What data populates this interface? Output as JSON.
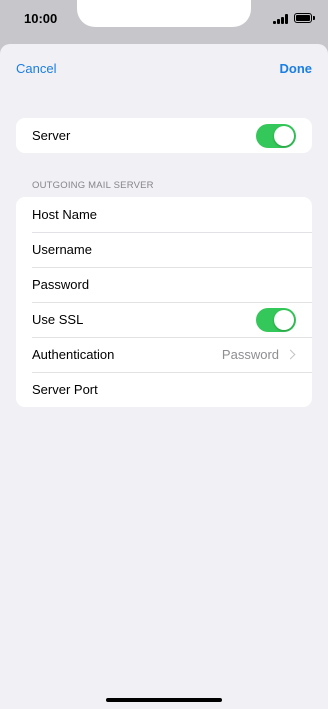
{
  "status_bar": {
    "time": "10:00",
    "signal_icon": "cellular-signal-icon",
    "battery_icon": "battery-icon"
  },
  "nav": {
    "cancel_label": "Cancel",
    "done_label": "Done"
  },
  "server_group": {
    "label": "Server",
    "toggle_on": true
  },
  "outgoing_section": {
    "header": "OUTGOING MAIL SERVER",
    "rows": {
      "host_name": "Host Name",
      "username": "Username",
      "password": "Password",
      "use_ssl": "Use SSL",
      "use_ssl_on": true,
      "authentication": "Authentication",
      "authentication_value": "Password",
      "server_port": "Server Port"
    }
  },
  "colors": {
    "accent": "#1a7ee3",
    "toggle_on": "#34c759",
    "background": "#f1f0f5"
  }
}
